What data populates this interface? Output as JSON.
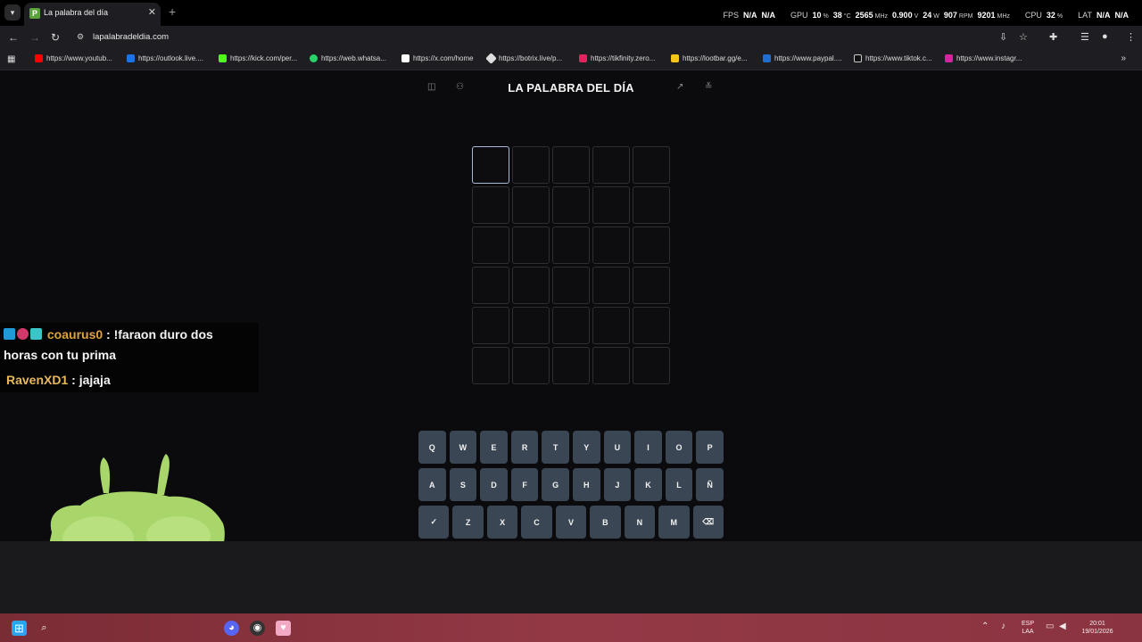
{
  "browser": {
    "tab_title": "La palabra del día",
    "tab_favicon_letter": "P",
    "tab_close": "✕",
    "new_tab": "+",
    "address": "lapalabradeldia.com"
  },
  "perf_overlay": {
    "fps_label": "FPS",
    "fps_value1": "N/A",
    "fps_value2": "N/A",
    "gpu_label": "GPU",
    "gpu_load": "10",
    "gpu_load_unit": "%",
    "gpu_temp": "38",
    "gpu_temp_unit": "°C",
    "gpu_clock": "2565",
    "gpu_clock_unit": "MHz",
    "gpu_volt": "0.900",
    "gpu_volt_unit": "V",
    "gpu_power": "24",
    "gpu_power_unit": "W",
    "gpu_fan": "907",
    "gpu_fan_unit": "RPM",
    "gpu_mem_clock": "9201",
    "gpu_mem_clock_unit": "MHz",
    "cpu_label": "CPU",
    "cpu_load": "32",
    "cpu_load_unit": "%",
    "lat_label": "LAT",
    "lat_value1": "N/A",
    "lat_value2": "N/A"
  },
  "bookmarks": [
    {
      "label": "https://www.youtub...",
      "icon": "youtube-icon",
      "color": "#ff0000"
    },
    {
      "label": "https://outlook.live....",
      "icon": "outlook-icon",
      "color": "#1a73e8"
    },
    {
      "label": "https://kick.com/per...",
      "icon": "kick-icon",
      "color": "#53fc18"
    },
    {
      "label": "https://web.whatsa...",
      "icon": "whatsapp-icon",
      "color": "#25d366"
    },
    {
      "label": "https://x.com/home",
      "icon": "x-icon",
      "color": "#ffffff"
    },
    {
      "label": "https://botrix.live/p...",
      "icon": "botrix-icon",
      "color": "#dddddd"
    },
    {
      "label": "https://tikfinity.zero...",
      "icon": "tikfinity-icon",
      "color": "#e0245e"
    },
    {
      "label": "https://lootbar.gg/e...",
      "icon": "lootbar-icon",
      "color": "#f5c518"
    },
    {
      "label": "https://www.paypal....",
      "icon": "paypal-icon",
      "color": "#1f6fd1"
    },
    {
      "label": "https://www.tiktok.c...",
      "icon": "tiktok-icon",
      "color": "#111111"
    },
    {
      "label": "https://www.instagr...",
      "icon": "instagram-icon",
      "color": "#d6249f"
    }
  ],
  "game": {
    "title": "LA PALABRA DEL DÍA",
    "rows": 6,
    "cols": 5,
    "keyboard": {
      "row1": [
        "Q",
        "W",
        "E",
        "R",
        "T",
        "Y",
        "U",
        "I",
        "O",
        "P"
      ],
      "row2": [
        "A",
        "S",
        "D",
        "F",
        "G",
        "H",
        "J",
        "K",
        "L",
        "Ñ"
      ],
      "row3": [
        "✓",
        "Z",
        "X",
        "C",
        "V",
        "B",
        "N",
        "M",
        "⌫"
      ]
    }
  },
  "chat": {
    "msg1_user": "coaurus0",
    "msg1_text_a": " : !faraon duro dos",
    "msg1_text_b": "horas con tu prima",
    "msg2_user": "RavenXD1",
    "msg2_text": " : jajaja"
  },
  "taskbar": {
    "lang_top": "ESP",
    "lang_bottom": "LAA",
    "time": "20:01",
    "date": "19/01/2026"
  },
  "colors": {
    "accent_active_cell": "#a9bbd8",
    "key_bg": "#3b4654",
    "taskbar": "#933946"
  }
}
